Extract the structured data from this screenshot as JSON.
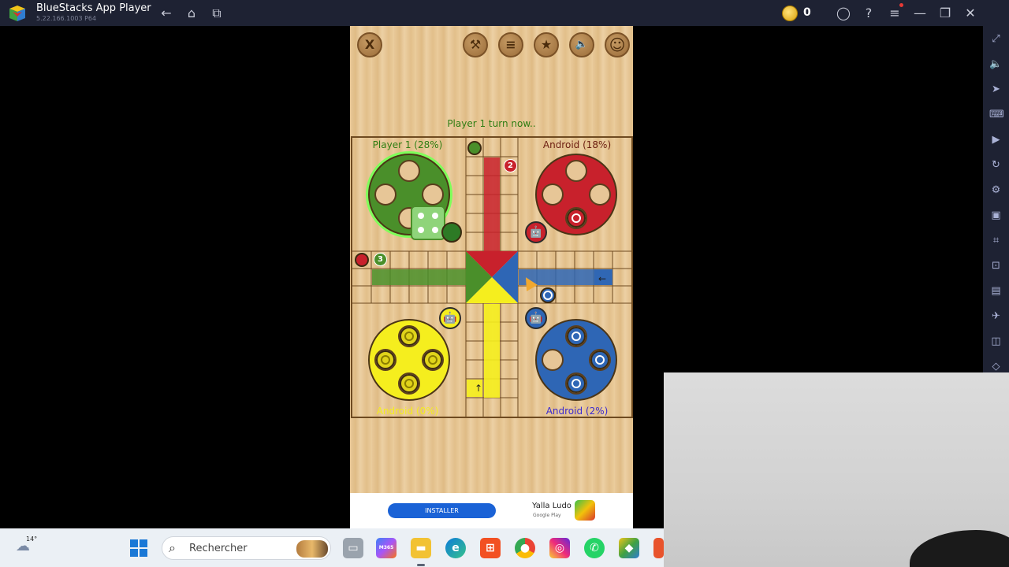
{
  "window": {
    "title": "BlueStacks App Player",
    "version": "5.22.166.1003 P64",
    "coins": "0"
  },
  "titlebar_icons": [
    "back-icon",
    "home-icon",
    "multi-instance-icon",
    "account-icon",
    "help-icon",
    "menu-icon",
    "minimize-icon",
    "restore-icon",
    "close-icon"
  ],
  "sidebar_icons": [
    "fullscreen-icon",
    "volume-icon",
    "cursor-icon",
    "keyboard-icon",
    "record-icon",
    "rotate-icon",
    "controls-icon",
    "apk-icon",
    "screenshot-icon",
    "resize-icon",
    "media-icon",
    "airplane-icon",
    "multi-window-icon",
    "eraser-icon"
  ],
  "game": {
    "top_buttons": [
      "X",
      "⚒",
      "≡",
      "★",
      "🔈",
      "☺"
    ],
    "turn_text": "Player 1 turn now..",
    "players": {
      "green": {
        "label": "Player 1 (28%)",
        "color": "#4a8f2a"
      },
      "red": {
        "label": "Android (18%)",
        "color": "#c8212c"
      },
      "yellow": {
        "label": "Android (0%)",
        "color": "#f5ee1e"
      },
      "blue": {
        "label": "Android (2%)",
        "color": "#2e66b5"
      }
    },
    "dice_value": 4,
    "stack_tokens": {
      "red_count": "2",
      "green_count": "3"
    }
  },
  "ad": {
    "button": "INSTALLER",
    "title": "Yalla Ludo",
    "subtitle": "Google Play"
  },
  "taskbar": {
    "temperature": "14°",
    "search_placeholder": "Rechercher",
    "m365_label": "M365"
  }
}
